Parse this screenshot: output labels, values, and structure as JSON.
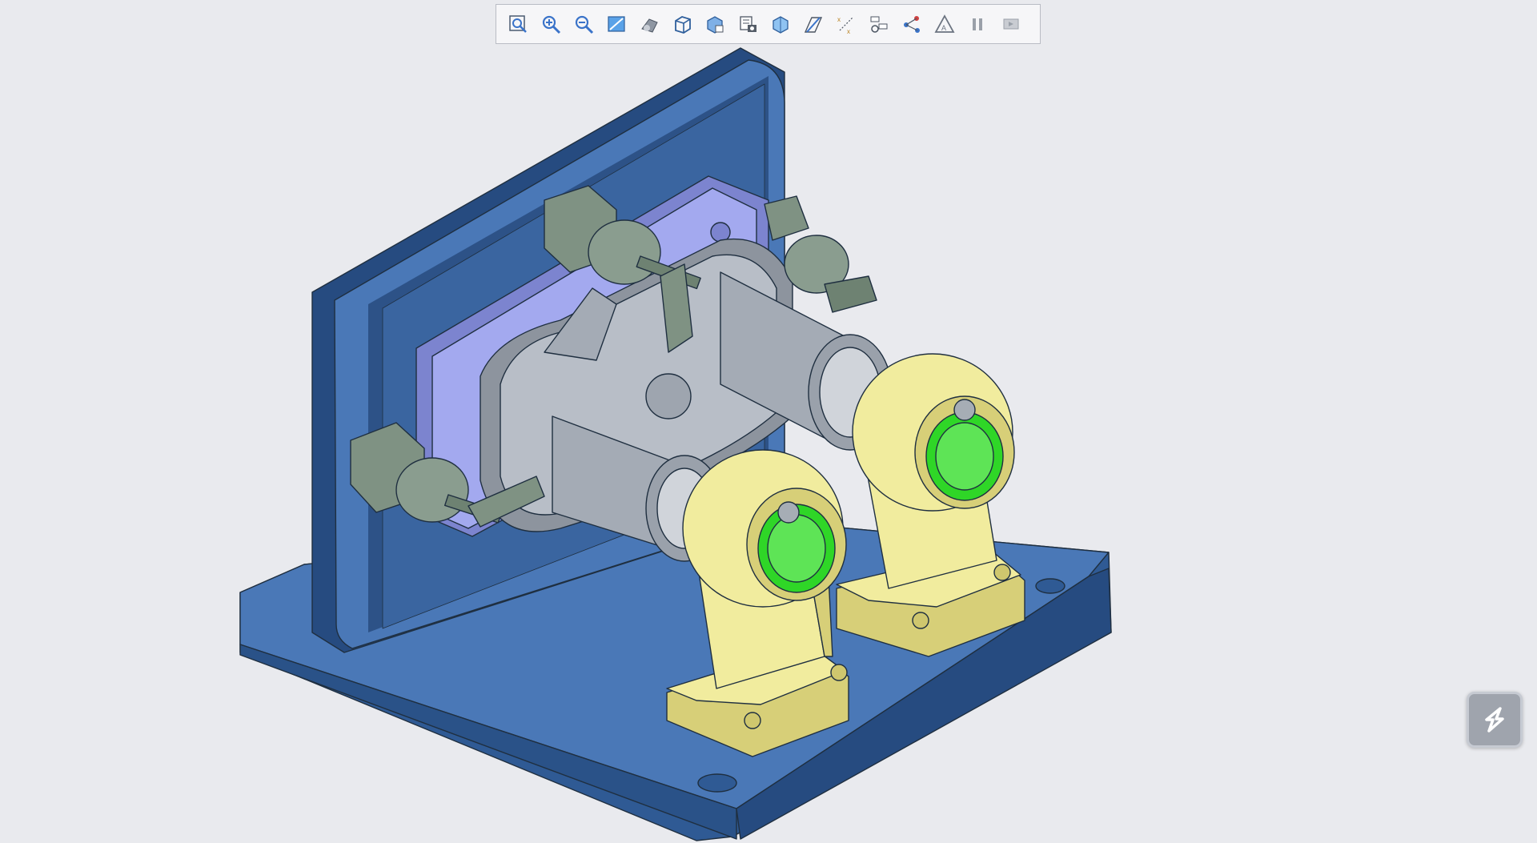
{
  "app": {
    "title": ""
  },
  "colors": {
    "background": "#e9eaee",
    "base_plate": "#4a78b7",
    "base_plate_dark": "#2f5a94",
    "base_plate_shadow": "#234a7e",
    "mount_plate": "#a3a9ef",
    "housing_gray": "#b8bec7",
    "housing_dark": "#8d949e",
    "cylinder_green": "#8a9d8f",
    "support_yellow": "#f1ec9e",
    "support_yellow_dark": "#d7cf78",
    "bushing_green": "#2fd627",
    "edge": "#1f2f40"
  },
  "toolbar": {
    "tools": [
      {
        "icon": "zoom-fit-icon",
        "tooltip": ""
      },
      {
        "icon": "zoom-in-icon",
        "tooltip": ""
      },
      {
        "icon": "zoom-out-icon",
        "tooltip": ""
      },
      {
        "icon": "normal-view-icon",
        "tooltip": ""
      },
      {
        "icon": "shaded-view-icon",
        "tooltip": ""
      },
      {
        "icon": "wireframe-box-icon",
        "tooltip": ""
      },
      {
        "icon": "saved-views-icon",
        "tooltip": ""
      },
      {
        "icon": "view-manager-icon",
        "tooltip": ""
      },
      {
        "icon": "section-view-icon",
        "tooltip": ""
      },
      {
        "icon": "plane-display-icon",
        "tooltip": ""
      },
      {
        "icon": "axis-display-icon",
        "tooltip": ""
      },
      {
        "icon": "appearance-icon",
        "tooltip": ""
      },
      {
        "icon": "point-display-icon",
        "tooltip": ""
      },
      {
        "icon": "annotation-display-icon",
        "tooltip": ""
      },
      {
        "icon": "pause-icon",
        "tooltip": ""
      },
      {
        "icon": "play-step-icon",
        "tooltip": ""
      }
    ]
  },
  "floating_button": {
    "icon": "smart-assist-icon"
  }
}
